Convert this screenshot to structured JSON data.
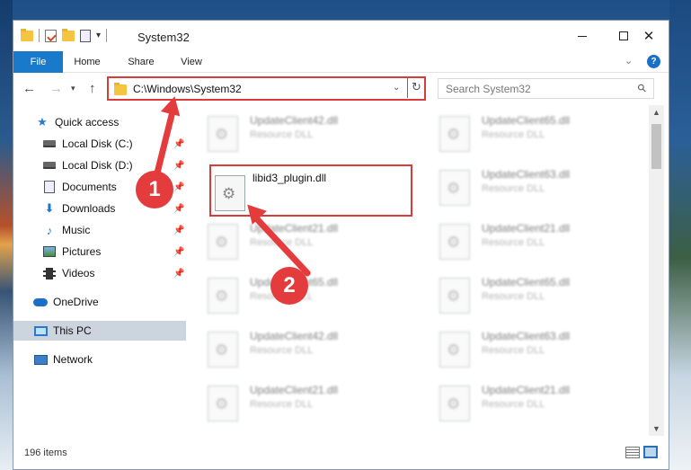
{
  "window": {
    "title": "System32"
  },
  "ribbon": {
    "tabs": [
      {
        "label": "File"
      },
      {
        "label": "Home"
      },
      {
        "label": "Share"
      },
      {
        "label": "View"
      }
    ]
  },
  "address": {
    "path": "C:\\Windows\\System32"
  },
  "search": {
    "placeholder": "Search System32"
  },
  "nav": {
    "quick_access": "Quick access",
    "items": [
      {
        "label": "Local Disk (C:)"
      },
      {
        "label": "Local Disk (D:)"
      },
      {
        "label": "Documents"
      },
      {
        "label": "Downloads"
      },
      {
        "label": "Music"
      },
      {
        "label": "Pictures"
      },
      {
        "label": "Videos"
      }
    ],
    "onedrive": "OneDrive",
    "this_pc": "This PC",
    "network": "Network"
  },
  "files": {
    "highlighted": {
      "name": "libid3_plugin.dll"
    },
    "left": [
      {
        "name": "UpdateClient42.dll",
        "desc": "Resource DLL"
      },
      {
        "name": "UpdateClient21.dll",
        "desc": "Resource DLL"
      },
      {
        "name": "UpdateClient65.dll",
        "desc": "Resource DLL"
      },
      {
        "name": "UpdateClient42.dll",
        "desc": "Resource DLL"
      },
      {
        "name": "UpdateClient21.dll",
        "desc": "Resource DLL"
      }
    ],
    "right": [
      {
        "name": "UpdateClient65.dll",
        "desc": "Resource DLL"
      },
      {
        "name": "UpdateClient63.dll",
        "desc": "Resource DLL"
      },
      {
        "name": "UpdateClient21.dll",
        "desc": "Resource DLL"
      },
      {
        "name": "UpdateClient65.dll",
        "desc": "Resource DLL"
      },
      {
        "name": "UpdateClient63.dll",
        "desc": "Resource DLL"
      },
      {
        "name": "UpdateClient21.dll",
        "desc": "Resource DLL"
      }
    ]
  },
  "status": {
    "items": "196 items"
  },
  "callouts": {
    "one": "1",
    "two": "2"
  },
  "colors": {
    "accent": "#1979ca",
    "highlight": "#d93b3b",
    "callout": "#e43c3c"
  }
}
